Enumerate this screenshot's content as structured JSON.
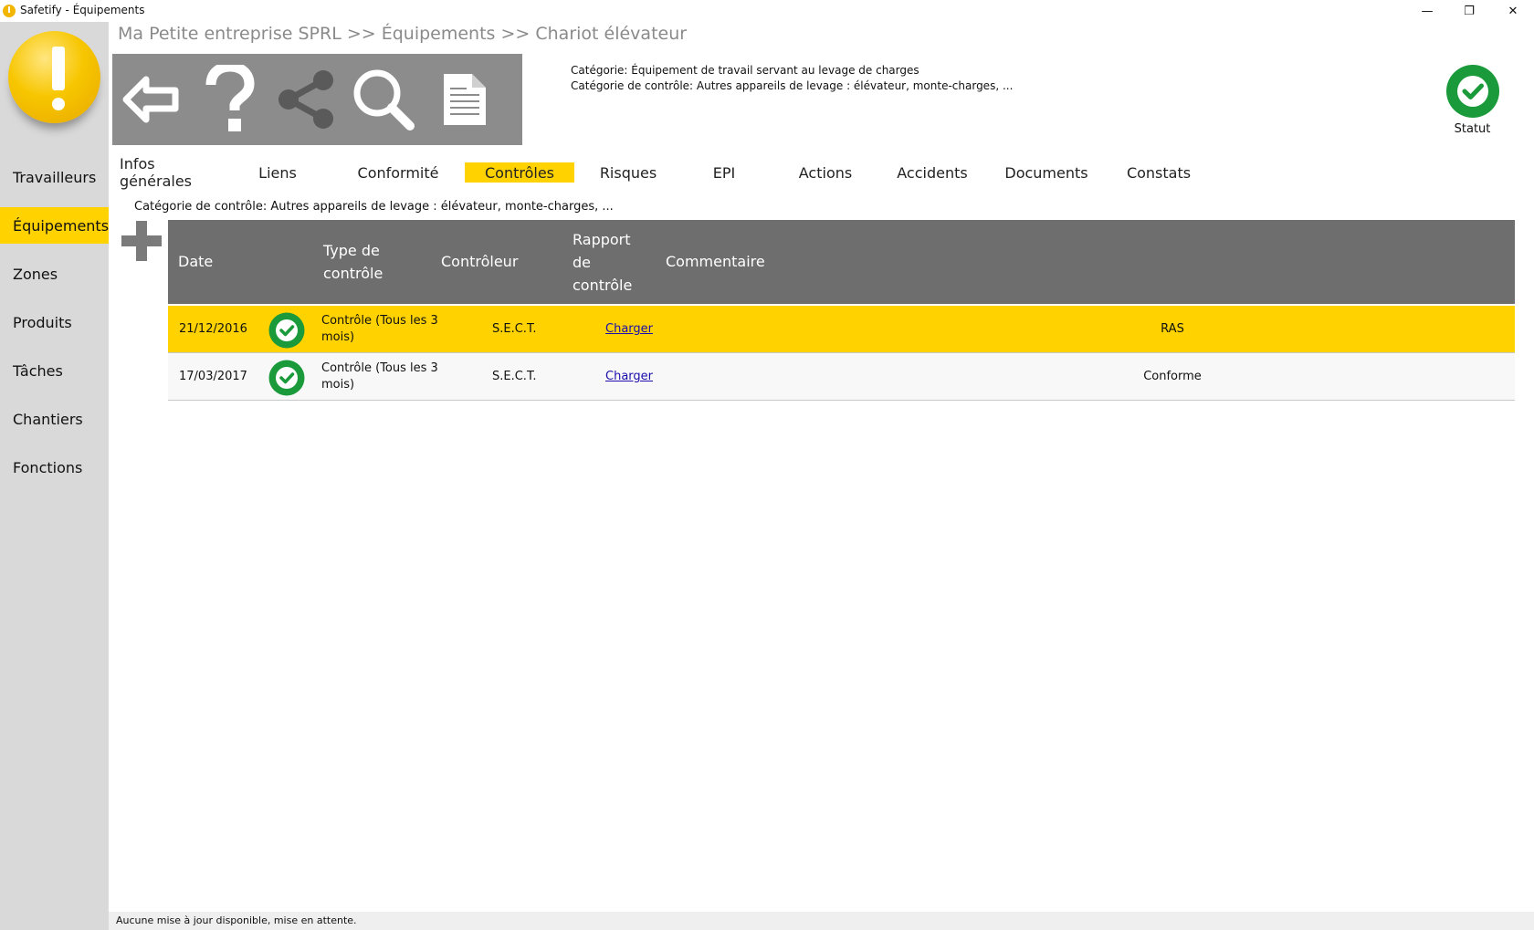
{
  "window": {
    "title": "Safetify - Équipements",
    "minimize_label": "—",
    "maximize_label": "❐",
    "close_label": "✕"
  },
  "sidebar": {
    "items": [
      {
        "label": "Travailleurs",
        "active": false
      },
      {
        "label": "Équipements",
        "active": true
      },
      {
        "label": "Zones",
        "active": false
      },
      {
        "label": "Produits",
        "active": false
      },
      {
        "label": "Tâches",
        "active": false
      },
      {
        "label": "Chantiers",
        "active": false
      },
      {
        "label": "Fonctions",
        "active": false
      }
    ]
  },
  "breadcrumb": "Ma Petite entreprise SPRL >> Équipements >> Chariot élévateur",
  "toolbar": {
    "icons": [
      "back-arrow-icon",
      "help-icon",
      "share-icon",
      "search-icon",
      "document-icon"
    ]
  },
  "info": {
    "category": "Catégorie: Équipement de travail servant au levage de charges",
    "control_category": "Catégorie de contrôle:  Autres appareils de levage : élévateur, monte-charges, ..."
  },
  "status": {
    "label": "Statut",
    "color": "#1a9a3a"
  },
  "tabs": [
    {
      "label": "Infos générales",
      "active": false
    },
    {
      "label": "Liens",
      "active": false
    },
    {
      "label": "Conformité",
      "active": false
    },
    {
      "label": "Contrôles",
      "active": true
    },
    {
      "label": "Risques",
      "active": false
    },
    {
      "label": "EPI",
      "active": false
    },
    {
      "label": "Actions",
      "active": false
    },
    {
      "label": "Accidents",
      "active": false
    },
    {
      "label": "Documents",
      "active": false
    },
    {
      "label": "Constats",
      "active": false
    }
  ],
  "subcategory": "Catégorie de contrôle: Autres appareils de levage : élévateur, monte-charges, ...",
  "table": {
    "headers": {
      "date": "Date",
      "type_line1": "Type de",
      "type_line2": "contrôle",
      "controller": "Contrôleur",
      "report_line1": "Rapport",
      "report_line2": "de",
      "report_line3": "contrôle",
      "comment": "Commentaire"
    },
    "rows": [
      {
        "date": "21/12/2016",
        "type": "Contrôle (Tous les 3 mois)",
        "controller": "S.E.C.T.",
        "report": "Charger",
        "comment": "RAS",
        "selected": true
      },
      {
        "date": "17/03/2017",
        "type": "Contrôle (Tous les 3 mois)",
        "controller": "S.E.C.T.",
        "report": "Charger",
        "comment": "Conforme",
        "selected": false
      }
    ]
  },
  "statusbar": "Aucune mise à jour disponible, mise en attente.",
  "colors": {
    "accent": "#ffd200",
    "sidebar": "#d9d9d9",
    "toolbar": "#8c8c8c",
    "table_header": "#6e6e6e",
    "check_green": "#1a9a3a"
  }
}
